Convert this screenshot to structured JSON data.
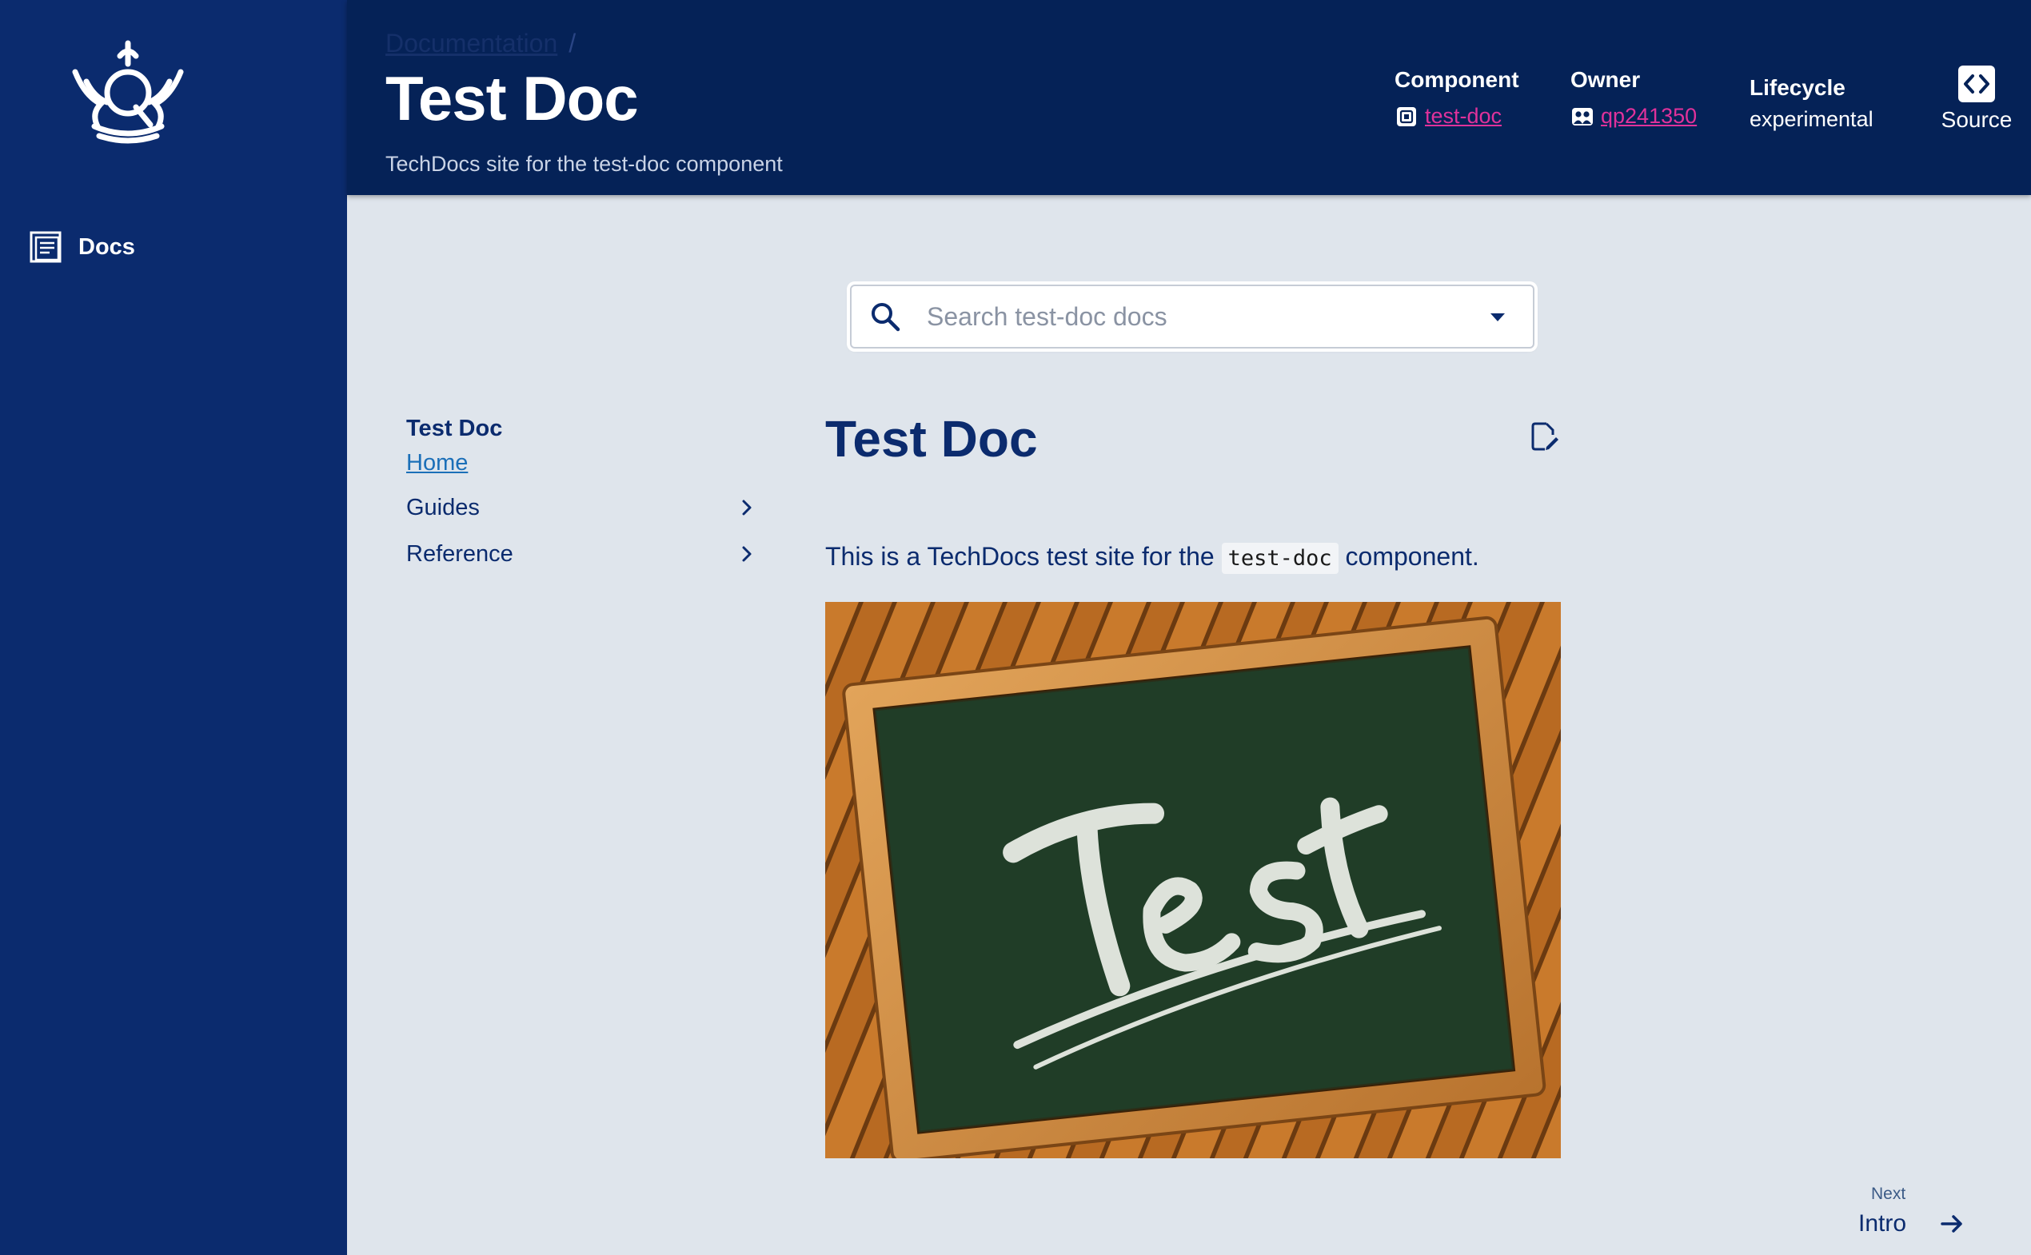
{
  "sidebar": {
    "logo": "queen-mary-crown-logo",
    "items": [
      {
        "label": "Docs",
        "icon": "docs-icon"
      }
    ]
  },
  "header": {
    "breadcrumb": [
      {
        "label": "Documentation"
      }
    ],
    "breadcrumb_separator": "/",
    "title": "Test Doc",
    "subtitle": "TechDocs site for the test-doc component",
    "component_label": "Component",
    "component_value": "test-doc",
    "owner_label": "Owner",
    "owner_value": "qp241350",
    "lifecycle_label": "Lifecycle",
    "lifecycle_value": "experimental",
    "source_label": "Source"
  },
  "search": {
    "placeholder": "Search test-doc docs",
    "value": ""
  },
  "nav": {
    "site_title": "Test Doc",
    "home_label": "Home",
    "items": [
      {
        "label": "Guides"
      },
      {
        "label": "Reference"
      }
    ]
  },
  "content": {
    "heading": "Test Doc",
    "paragraph_before": "This is a TechDocs test site for the",
    "code": "test-doc",
    "paragraph_after": "component.",
    "image_text": "Test"
  },
  "footer_nav": {
    "next_label": "Next",
    "next_title": "Intro"
  },
  "colors": {
    "sidebar_bg": "#0b2b6e",
    "header_bg": "#052257",
    "page_bg": "#dfe5ec",
    "link_accent": "#e0329b",
    "text_primary": "#0b2b6e",
    "link_blue": "#1b6fb8"
  }
}
